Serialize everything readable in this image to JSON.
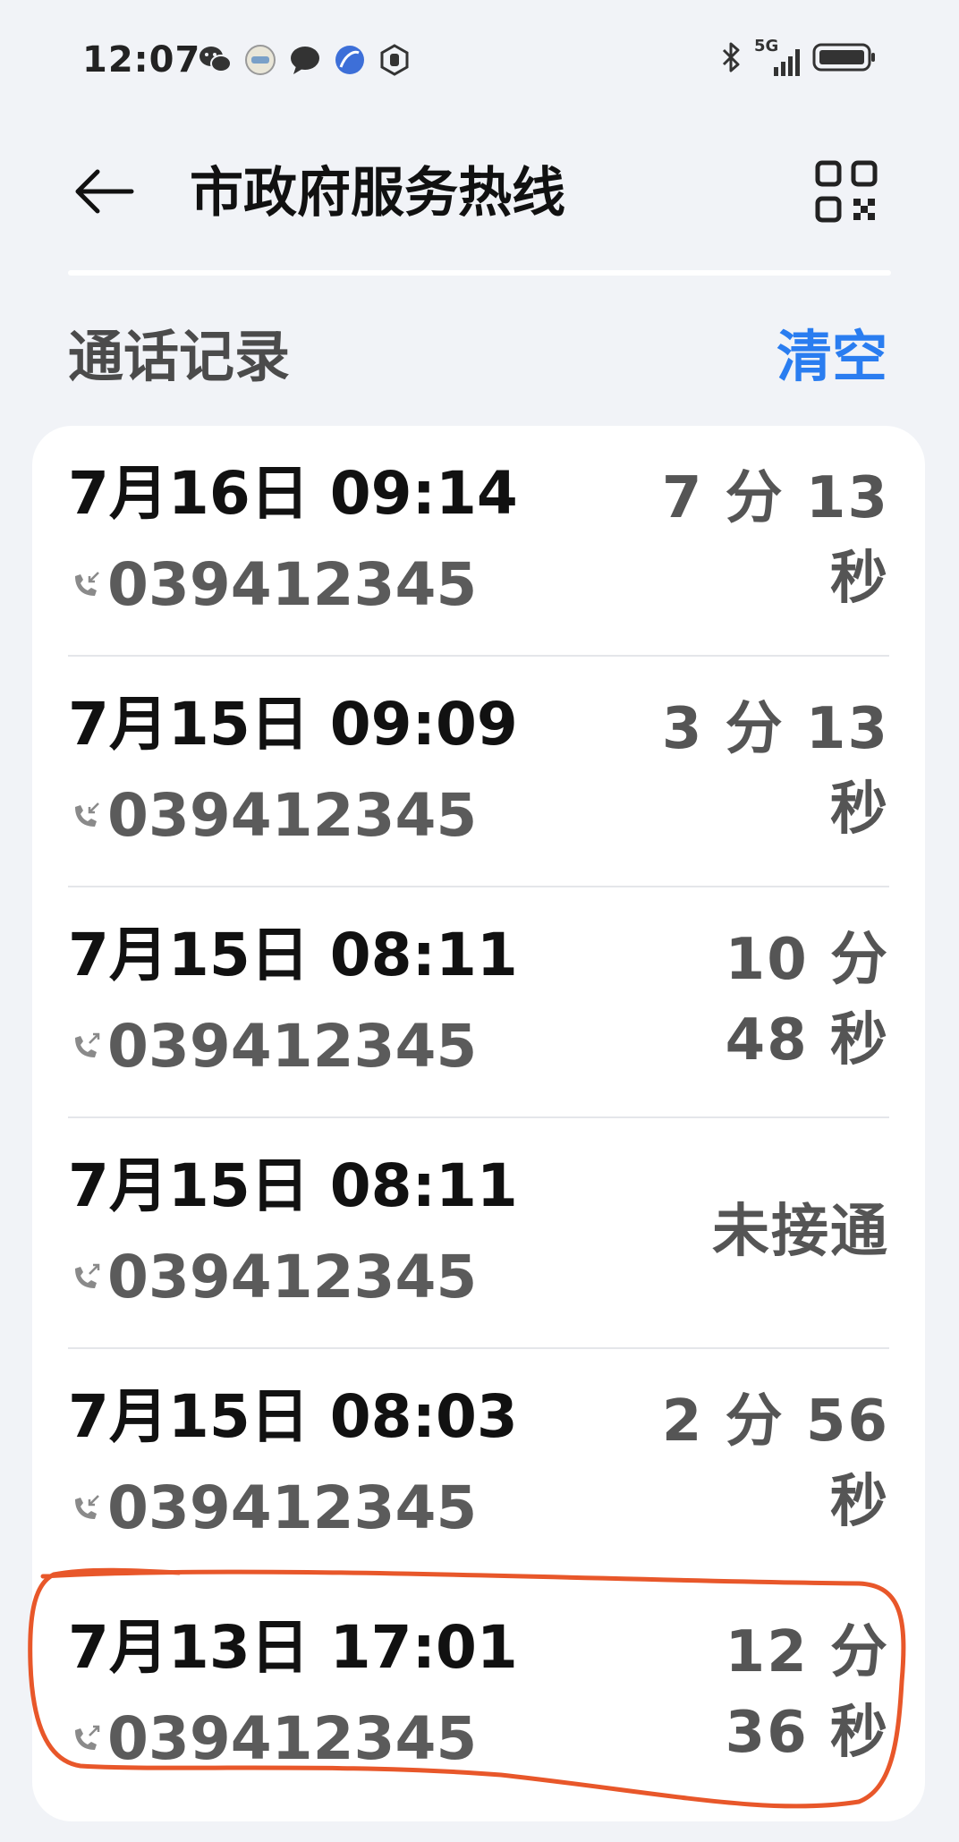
{
  "status_bar": {
    "time": "12:07",
    "left_icons": [
      "wechat-icon",
      "app-badge-icon",
      "chat-bubble-icon",
      "browser-icon",
      "shield-hand-icon"
    ],
    "right_icons": [
      "bluetooth-icon",
      "signal-5g-icon",
      "battery-icon"
    ],
    "network_label": "5G"
  },
  "header": {
    "title": "市政府服务热线",
    "back_icon": "arrow-left-icon",
    "qr_icon": "qr-code-icon"
  },
  "section": {
    "title": "通话记录",
    "clear_label": "清空"
  },
  "calls": [
    {
      "datetime": "7月16日 09:14",
      "number": "039412345",
      "direction": "incoming",
      "duration_line1": "7 分 13",
      "duration_line2": "秒"
    },
    {
      "datetime": "7月15日 09:09",
      "number": "039412345",
      "direction": "incoming",
      "duration_line1": "3 分 13",
      "duration_line2": "秒"
    },
    {
      "datetime": "7月15日 08:11",
      "number": "039412345",
      "direction": "outgoing",
      "duration_line1": "10 分",
      "duration_line2": "48 秒"
    },
    {
      "datetime": "7月15日 08:11",
      "number": "039412345",
      "direction": "outgoing",
      "duration_line1": "未接通",
      "duration_line2": ""
    },
    {
      "datetime": "7月15日 08:03",
      "number": "039412345",
      "direction": "incoming",
      "duration_line1": "2 分 56",
      "duration_line2": "秒"
    },
    {
      "datetime": "7月13日 17:01",
      "number": "039412345",
      "direction": "outgoing",
      "duration_line1": "12 分",
      "duration_line2": "36 秒"
    }
  ],
  "colors": {
    "accent": "#2a7df0",
    "annotation": "#e8572a",
    "background": "#f1f3f7"
  }
}
